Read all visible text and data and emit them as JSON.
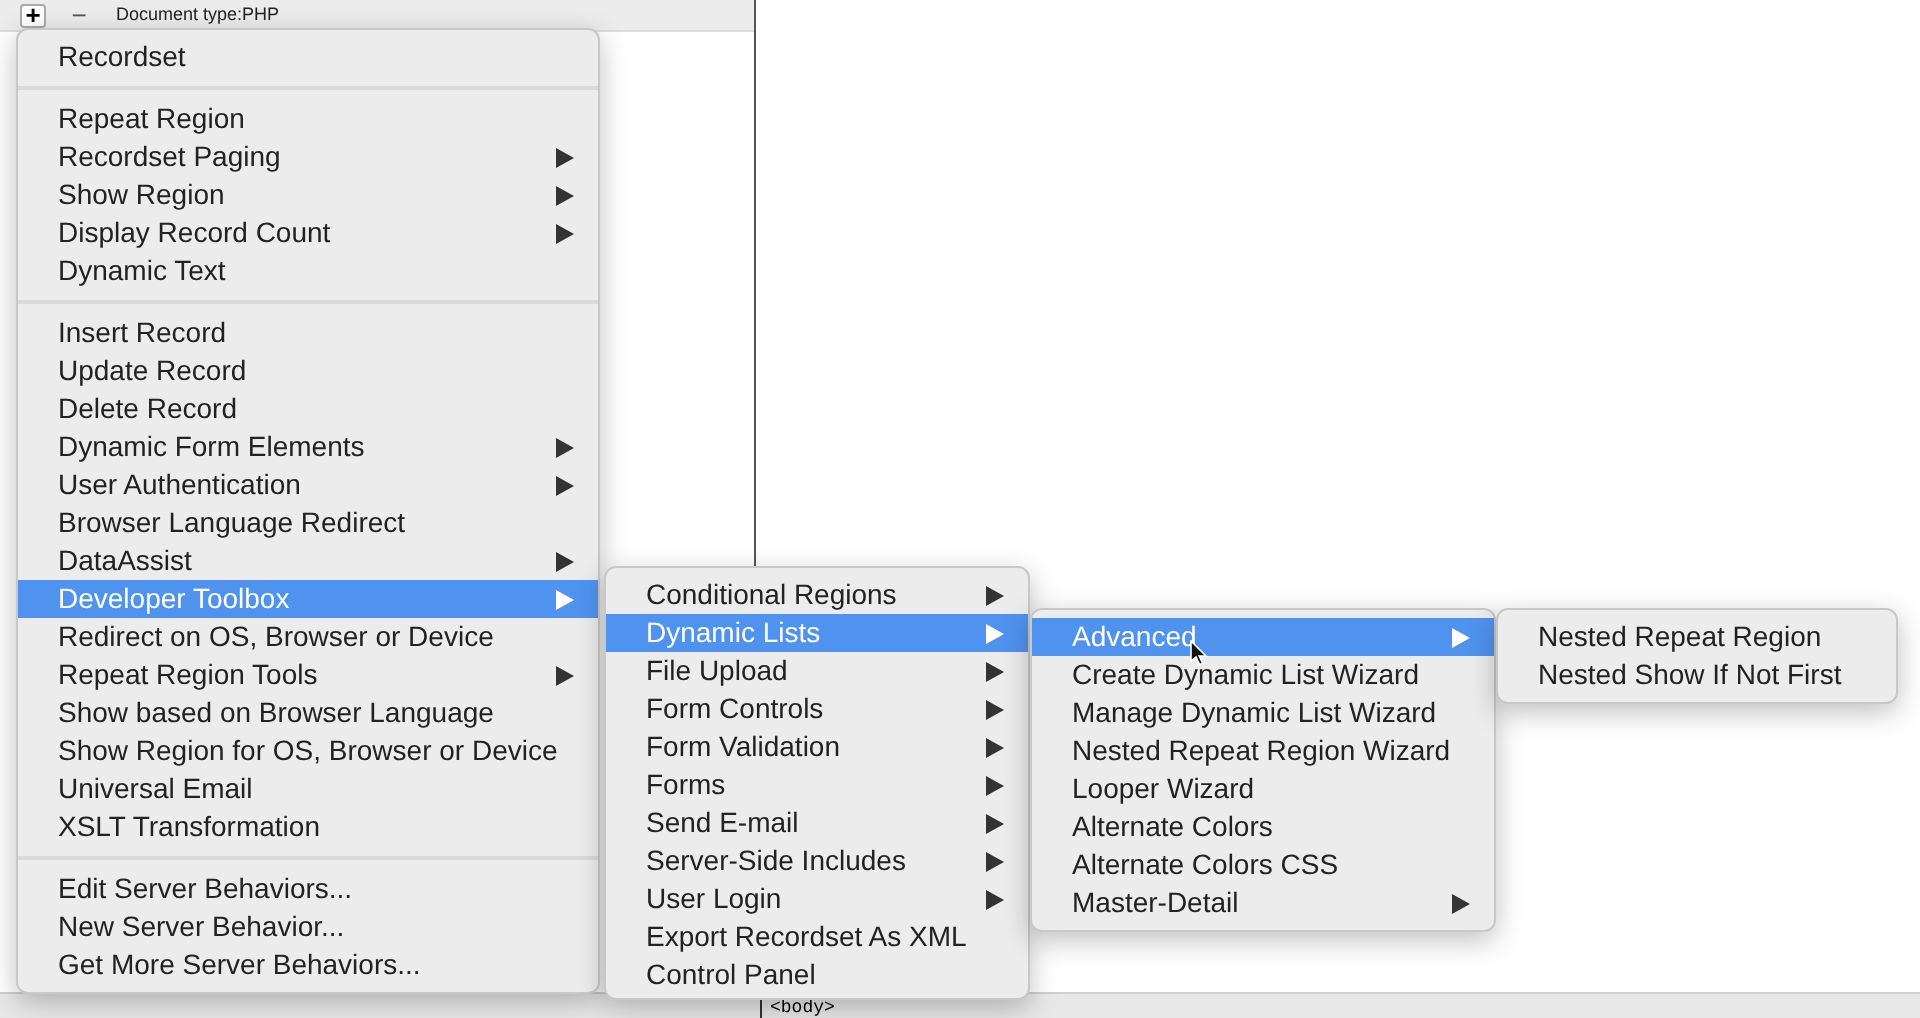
{
  "toolbar": {
    "add_label": "+",
    "remove_label": "−",
    "document_type": "Document type:PHP"
  },
  "status_bar": {
    "tag": "<body>"
  },
  "menus": [
    {
      "items": [
        {
          "kind": "item",
          "label": "Recordset",
          "submenu": false,
          "selected": false
        },
        {
          "kind": "separator"
        },
        {
          "kind": "item",
          "label": "Repeat Region",
          "submenu": false,
          "selected": false
        },
        {
          "kind": "item",
          "label": "Recordset Paging",
          "submenu": true,
          "selected": false
        },
        {
          "kind": "item",
          "label": "Show Region",
          "submenu": true,
          "selected": false
        },
        {
          "kind": "item",
          "label": "Display Record Count",
          "submenu": true,
          "selected": false
        },
        {
          "kind": "item",
          "label": "Dynamic Text",
          "submenu": false,
          "selected": false
        },
        {
          "kind": "separator"
        },
        {
          "kind": "item",
          "label": "Insert Record",
          "submenu": false,
          "selected": false
        },
        {
          "kind": "item",
          "label": "Update Record",
          "submenu": false,
          "selected": false
        },
        {
          "kind": "item",
          "label": "Delete Record",
          "submenu": false,
          "selected": false
        },
        {
          "kind": "item",
          "label": "Dynamic Form Elements",
          "submenu": true,
          "selected": false
        },
        {
          "kind": "item",
          "label": "User Authentication",
          "submenu": true,
          "selected": false
        },
        {
          "kind": "item",
          "label": "Browser Language Redirect",
          "submenu": false,
          "selected": false
        },
        {
          "kind": "item",
          "label": "DataAssist",
          "submenu": true,
          "selected": false
        },
        {
          "kind": "item",
          "label": "Developer Toolbox",
          "submenu": true,
          "selected": true
        },
        {
          "kind": "item",
          "label": "Redirect on OS, Browser or Device",
          "submenu": false,
          "selected": false
        },
        {
          "kind": "item",
          "label": "Repeat Region Tools",
          "submenu": true,
          "selected": false
        },
        {
          "kind": "item",
          "label": "Show based on Browser Language",
          "submenu": false,
          "selected": false
        },
        {
          "kind": "item",
          "label": "Show Region for OS, Browser or Device",
          "submenu": false,
          "selected": false
        },
        {
          "kind": "item",
          "label": "Universal Email",
          "submenu": false,
          "selected": false
        },
        {
          "kind": "item",
          "label": "XSLT Transformation",
          "submenu": false,
          "selected": false
        },
        {
          "kind": "separator"
        },
        {
          "kind": "item",
          "label": "Edit Server Behaviors...",
          "submenu": false,
          "selected": false
        },
        {
          "kind": "item",
          "label": "New Server Behavior...",
          "submenu": false,
          "selected": false
        },
        {
          "kind": "item",
          "label": "Get More Server Behaviors...",
          "submenu": false,
          "selected": false
        }
      ]
    },
    {
      "items": [
        {
          "kind": "item",
          "label": "Conditional Regions",
          "submenu": true,
          "selected": false
        },
        {
          "kind": "item",
          "label": "Dynamic Lists",
          "submenu": true,
          "selected": true
        },
        {
          "kind": "item",
          "label": "File Upload",
          "submenu": true,
          "selected": false
        },
        {
          "kind": "item",
          "label": "Form Controls",
          "submenu": true,
          "selected": false
        },
        {
          "kind": "item",
          "label": "Form Validation",
          "submenu": true,
          "selected": false
        },
        {
          "kind": "item",
          "label": "Forms",
          "submenu": true,
          "selected": false
        },
        {
          "kind": "item",
          "label": "Send E-mail",
          "submenu": true,
          "selected": false
        },
        {
          "kind": "item",
          "label": "Server-Side Includes",
          "submenu": true,
          "selected": false
        },
        {
          "kind": "item",
          "label": "User Login",
          "submenu": true,
          "selected": false
        },
        {
          "kind": "item",
          "label": "Export Recordset As XML",
          "submenu": false,
          "selected": false
        },
        {
          "kind": "item",
          "label": "Control Panel",
          "submenu": false,
          "selected": false
        }
      ]
    },
    {
      "items": [
        {
          "kind": "item",
          "label": "Advanced",
          "submenu": true,
          "selected": true
        },
        {
          "kind": "item",
          "label": "Create Dynamic List Wizard",
          "submenu": false,
          "selected": false
        },
        {
          "kind": "item",
          "label": "Manage Dynamic List Wizard",
          "submenu": false,
          "selected": false
        },
        {
          "kind": "item",
          "label": "Nested Repeat Region Wizard",
          "submenu": false,
          "selected": false
        },
        {
          "kind": "item",
          "label": "Looper Wizard",
          "submenu": false,
          "selected": false
        },
        {
          "kind": "item",
          "label": "Alternate Colors",
          "submenu": false,
          "selected": false
        },
        {
          "kind": "item",
          "label": "Alternate Colors CSS",
          "submenu": false,
          "selected": false
        },
        {
          "kind": "item",
          "label": "Master-Detail",
          "submenu": true,
          "selected": false
        }
      ]
    },
    {
      "items": [
        {
          "kind": "item",
          "label": "Nested Repeat Region",
          "submenu": false,
          "selected": false
        },
        {
          "kind": "item",
          "label": "Nested Show If Not First",
          "submenu": false,
          "selected": false
        }
      ]
    }
  ]
}
